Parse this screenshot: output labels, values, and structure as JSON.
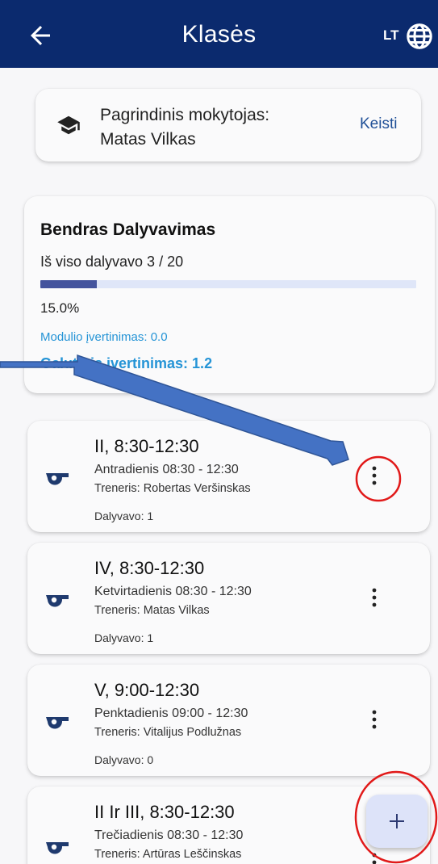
{
  "appbar": {
    "title": "Klasės",
    "lang_code": "LT",
    "icons": {
      "back": "arrow-left-icon",
      "language": "globe-icon"
    }
  },
  "teacher": {
    "label": "Pagrindinis mokytojas:",
    "name": "Matas Vilkas",
    "change_label": "Keisti",
    "icon": "graduation-cap-icon"
  },
  "stats": {
    "title": "Bendras Dalyvavimas",
    "total_label": "Iš viso dalyvavo 3 / 20",
    "progress": 0.15,
    "percent_label": "15.0%",
    "module_grade_label": "Modulio įvertinimas: 0.0",
    "final_grade_label": "Galutinis įvertinimas: 1.2"
  },
  "sessions": [
    {
      "title": "II, 8:30-12:30",
      "day": "Antradienis 08:30 - 12:30",
      "coach": "Treneris: Robertas Veršinskas",
      "attendance": "Dalyvavo: 1"
    },
    {
      "title": "IV, 8:30-12:30",
      "day": "Ketvirtadienis 08:30 - 12:30",
      "coach": "Treneris: Matas Vilkas",
      "attendance": "Dalyvavo: 1"
    },
    {
      "title": "V, 9:00-12:30",
      "day": "Penktadienis 09:00 - 12:30",
      "coach": "Treneris: Vitalijus Podlužnas",
      "attendance": "Dalyvavo: 0"
    },
    {
      "title": "II Ir III, 8:30-12:30",
      "day": "Trečiadienis 08:30 - 12:30",
      "coach": "Treneris: Artūras Leščinskas",
      "attendance": ""
    }
  ],
  "fab": {
    "icon": "plus-icon"
  },
  "colors": {
    "appbar": "#0b2a6e",
    "accent_link": "#1f4f97",
    "grade_text": "#2594d6",
    "progress_fill": "#43539d",
    "progress_track": "#dfe6f8",
    "annotation_circle": "#e11919",
    "annotation_arrow": "#4472c4"
  }
}
